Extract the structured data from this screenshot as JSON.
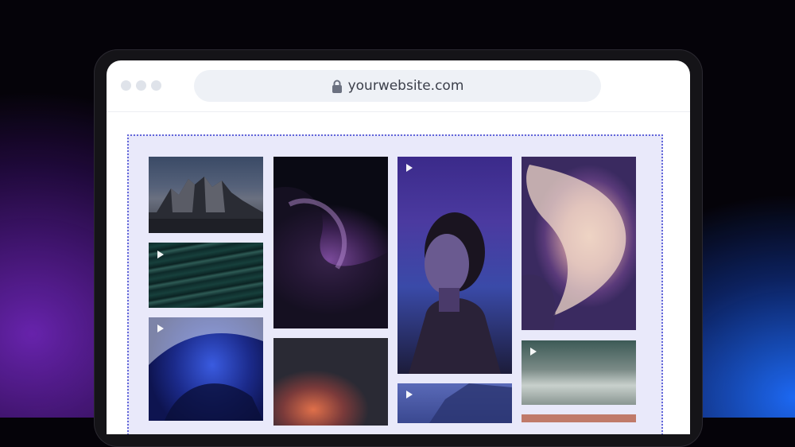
{
  "browser": {
    "url": "yourwebsite.com",
    "window_controls": [
      "dot",
      "dot",
      "dot"
    ]
  },
  "gallery": {
    "tiles": [
      {
        "kind": "image",
        "subject": "mountain-peaks"
      },
      {
        "kind": "video",
        "subject": "water-waves"
      },
      {
        "kind": "video",
        "subject": "blue-abstract"
      },
      {
        "kind": "image",
        "subject": "purple-abstract"
      },
      {
        "kind": "image",
        "subject": "orange-gradient"
      },
      {
        "kind": "video",
        "subject": "portrait"
      },
      {
        "kind": "video",
        "subject": "blue-landscape"
      },
      {
        "kind": "image",
        "subject": "fabric-abstract"
      },
      {
        "kind": "video",
        "subject": "waterfall"
      },
      {
        "kind": "image",
        "subject": "peach-tile"
      }
    ]
  },
  "colors": {
    "accent_dotted_border": "#6266d9",
    "gallery_background": "#e9e9fa",
    "url_bar_background": "#eef1f6"
  },
  "icons": {
    "lock": "lock-icon",
    "play": "play-icon"
  }
}
